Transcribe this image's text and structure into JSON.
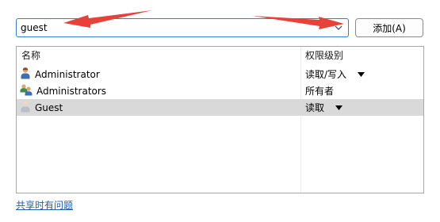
{
  "user_input": {
    "value": "guest"
  },
  "add_button": {
    "label": "添加(A)"
  },
  "table": {
    "columns": [
      "名称",
      "权限级别"
    ],
    "rows": [
      {
        "name": "Administrator",
        "icon": "user-icon",
        "permission": "读取/写入",
        "has_dropdown": true,
        "selected": false
      },
      {
        "name": "Administrators",
        "icon": "user-group-icon",
        "permission": "所有者",
        "has_dropdown": false,
        "selected": false
      },
      {
        "name": "Guest",
        "icon": "guest-user-icon",
        "permission": "读取",
        "has_dropdown": true,
        "selected": true
      }
    ]
  },
  "help_link": {
    "label": "共享时有问题"
  },
  "annotations": {
    "arrow_color": "#e8413a"
  },
  "colors": {
    "accent": "#3a7bd5",
    "link": "#1a5fb4",
    "selection": "#d9d9d9"
  }
}
